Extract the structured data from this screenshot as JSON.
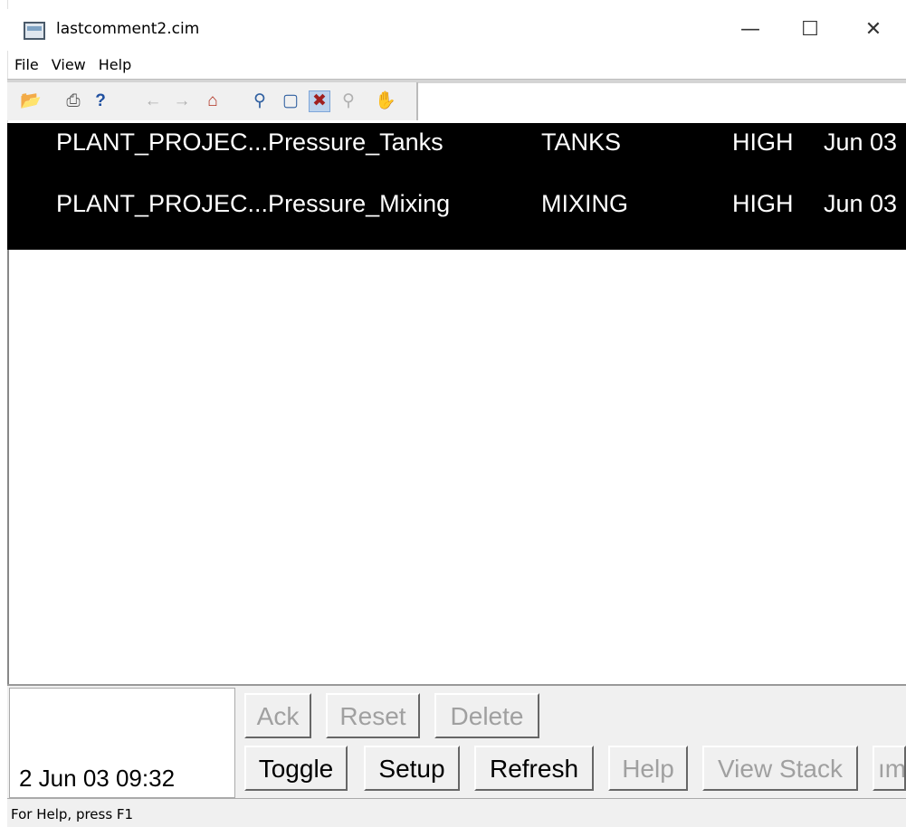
{
  "window": {
    "title": "lastcomment2.cim",
    "minimize_glyph": "—",
    "maximize_glyph": "☐",
    "close_glyph": "✕"
  },
  "menu": [
    "File",
    "View",
    "Help"
  ],
  "toolbar": {
    "icons": [
      "open-folder-icon",
      "print-icon",
      "context-help-icon",
      "back-arrow-icon",
      "forward-arrow-icon",
      "home-icon",
      "zoom-icon",
      "zoom-window-icon",
      "zoom-extents-icon",
      "zoom-in-icon",
      "pan-icon"
    ]
  },
  "alarms": [
    {
      "name": "PLANT_PROJEC...Pressure_Tanks",
      "area": "TANKS",
      "priority": "HIGH",
      "date": "Jun 03"
    },
    {
      "name": "PLANT_PROJEC...Pressure_Mixing",
      "area": "MIXING",
      "priority": "HIGH",
      "date": "Jun 03"
    }
  ],
  "datetime": "2 Jun 03 09:32",
  "buttons": {
    "ack": "Ack",
    "reset": "Reset",
    "delete": "Delete",
    "toggle": "Toggle",
    "setup": "Setup",
    "refresh": "Refresh",
    "help": "Help",
    "view_stack": "View Stack",
    "comment_partial": "ıme"
  },
  "status_text": "For Help, press F1"
}
